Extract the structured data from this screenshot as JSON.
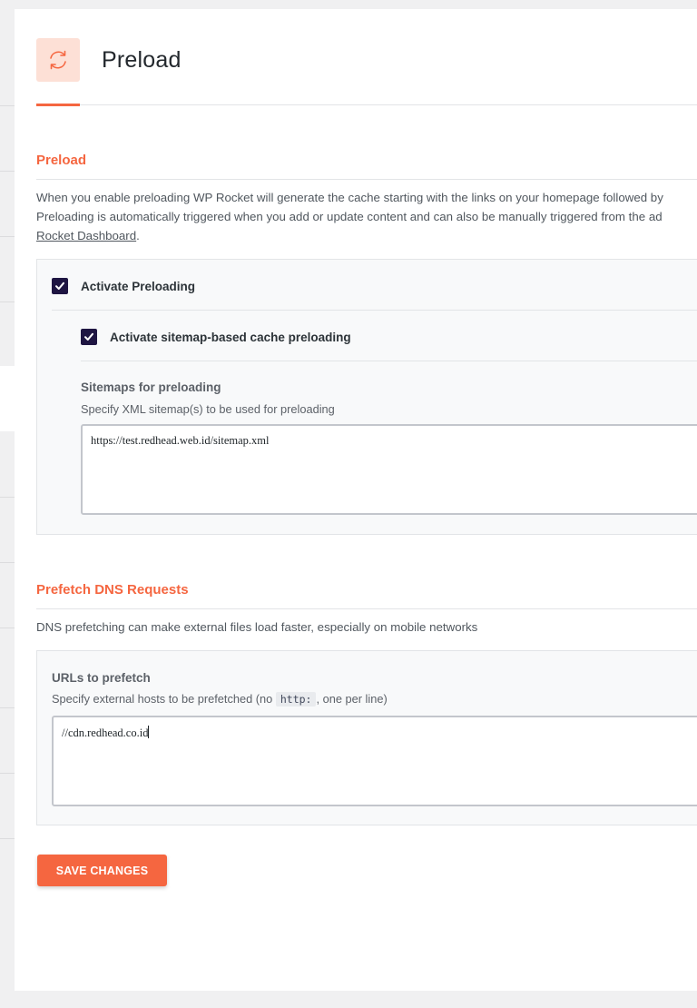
{
  "header": {
    "icon": "refresh-icon",
    "title": "Preload"
  },
  "preload_section": {
    "title": "Preload",
    "description_line1": "When you enable preloading WP Rocket will generate the cache starting with the links on your homepage followed by",
    "description_line2": "Preloading is automatically triggered when you add or update content and can also be manually triggered from the ad",
    "description_link": "Rocket Dashboard",
    "description_end": ".",
    "activate_preloading_label": "Activate Preloading",
    "activate_preloading_checked": true,
    "sitemap_preloading_label": "Activate sitemap-based cache preloading",
    "sitemap_preloading_checked": true,
    "sitemaps_field_label": "Sitemaps for preloading",
    "sitemaps_field_help": "Specify XML sitemap(s) to be used for preloading",
    "sitemaps_value": "https://test.redhead.web.id/sitemap.xml"
  },
  "prefetch_section": {
    "title": "Prefetch DNS Requests",
    "description": "DNS prefetching can make external files load faster, especially on mobile networks",
    "urls_field_label": "URLs to prefetch",
    "urls_help_before": "Specify external hosts to be prefetched (no ",
    "urls_help_code": "http:",
    "urls_help_after": ", one per line)",
    "urls_value": "//cdn.redhead.co.id"
  },
  "actions": {
    "save_label": "Save Changes"
  },
  "colors": {
    "accent": "#f56640",
    "checkbox": "#1e1542",
    "icon_bg": "#fde0d6"
  }
}
